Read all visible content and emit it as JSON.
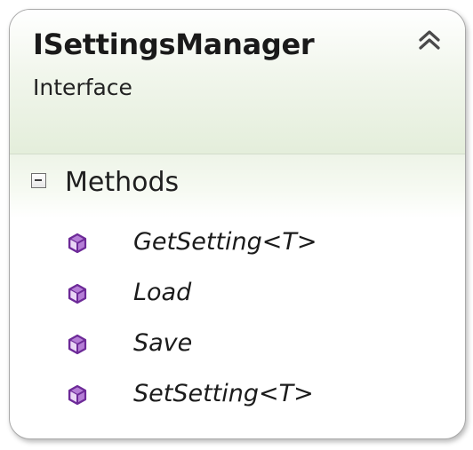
{
  "class_box": {
    "title": "ISettingsManager",
    "subtitle": "Interface",
    "collapse_icon": "double-chevron-up-icon",
    "section": {
      "label": "Methods",
      "toggle_icon": "minus-box-icon",
      "members": [
        {
          "name": "GetSetting<T>",
          "icon": "method-cube-icon"
        },
        {
          "name": "Load",
          "icon": "method-cube-icon"
        },
        {
          "name": "Save",
          "icon": "method-cube-icon"
        },
        {
          "name": "SetSetting<T>",
          "icon": "method-cube-icon"
        }
      ]
    }
  },
  "colors": {
    "header_tint": "#e4eedb",
    "border": "#a9a9a9",
    "method_icon": "#8b3fb5"
  }
}
